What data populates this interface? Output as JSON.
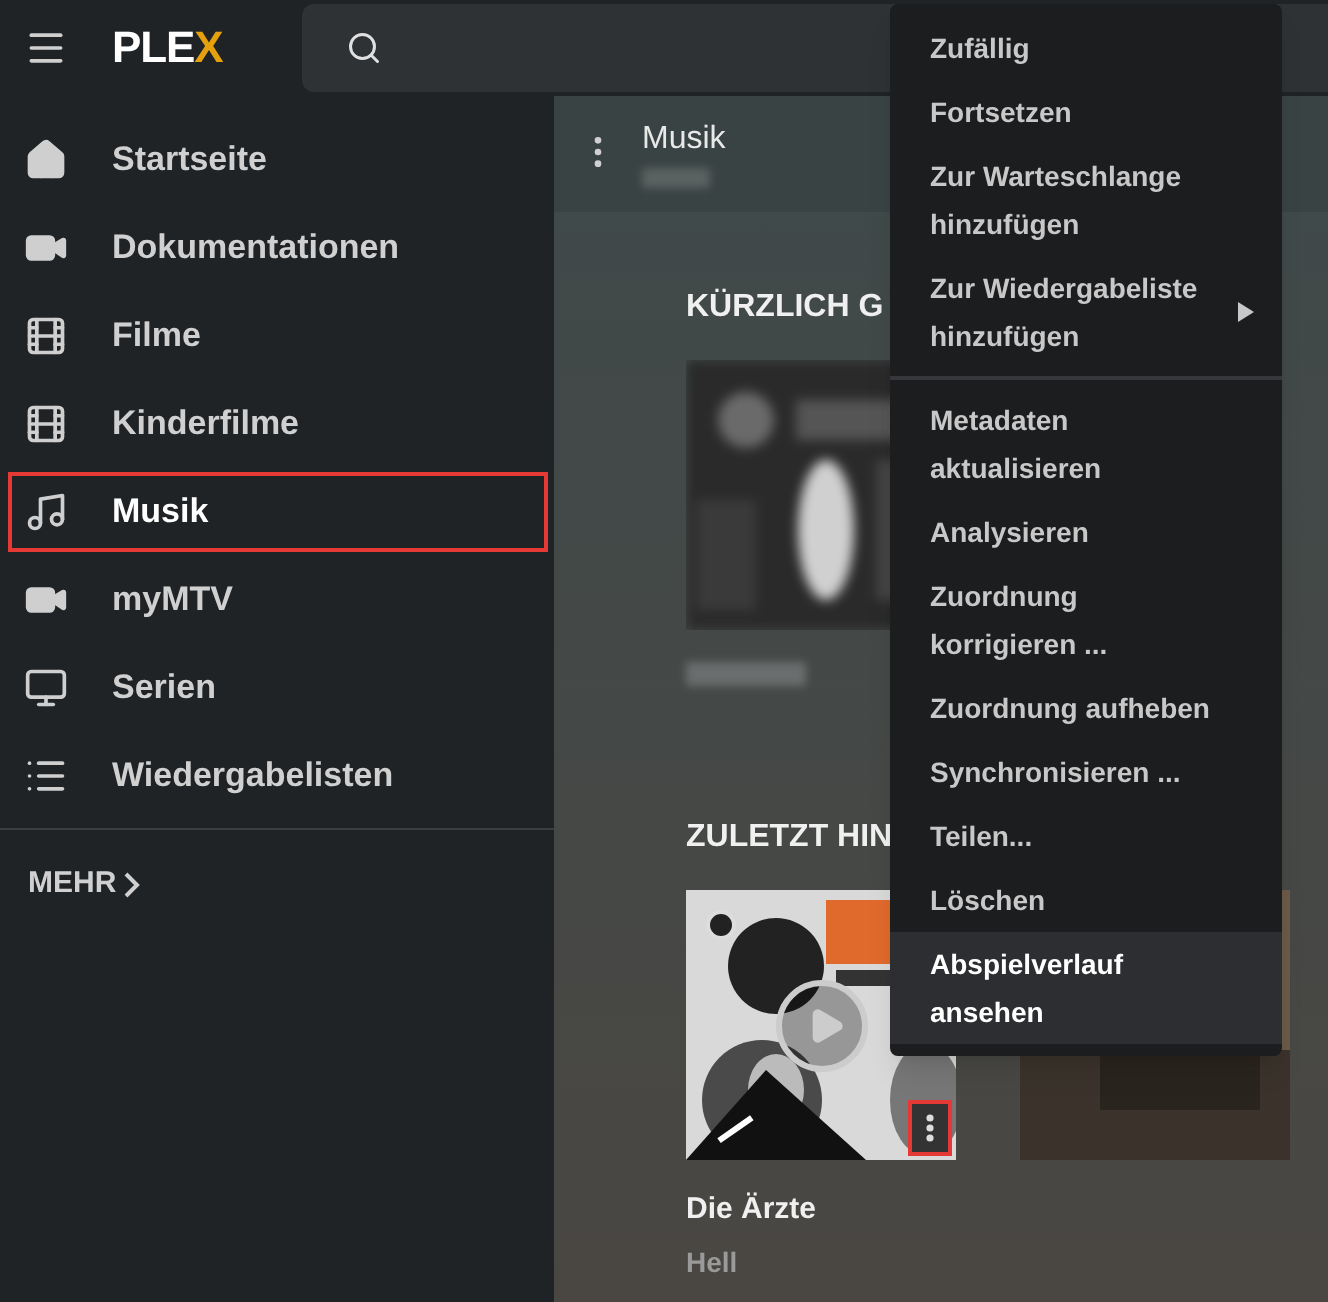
{
  "logo": {
    "text": "PLE",
    "accent": "X"
  },
  "sidebar": {
    "items": [
      {
        "label": "Startseite",
        "selected": false
      },
      {
        "label": "Dokumentationen",
        "selected": false
      },
      {
        "label": "Filme",
        "selected": false
      },
      {
        "label": "Kinderfilme",
        "selected": false
      },
      {
        "label": "Musik",
        "selected": true
      },
      {
        "label": "myMTV",
        "selected": false
      },
      {
        "label": "Serien",
        "selected": false
      },
      {
        "label": "Wiedergabelisten",
        "selected": false
      }
    ],
    "more": "MEHR"
  },
  "library": {
    "title": "Musik"
  },
  "sections": [
    {
      "heading": "KÜRZLICH G",
      "cards": [
        {
          "kind": "picture"
        }
      ]
    },
    {
      "heading": "ZULETZT HIN",
      "cards": [
        {
          "kind": "picture",
          "title": "Die Ärzte",
          "subtitle": "Hell",
          "highlighted_menu": true
        },
        {
          "kind": "picture"
        }
      ]
    }
  ],
  "context_menu": {
    "groups": [
      [
        {
          "label": "Zufällig",
          "submenu": false,
          "selected": false
        },
        {
          "label": "Fortsetzen",
          "submenu": false,
          "selected": false
        },
        {
          "label": "Zur Warteschlange hinzufügen",
          "submenu": false,
          "selected": false
        },
        {
          "label": "Zur Wiedergabeliste hinzufügen",
          "submenu": true,
          "selected": false
        }
      ],
      [
        {
          "label": "Metadaten aktualisieren",
          "submenu": false,
          "selected": false
        },
        {
          "label": "Analysieren",
          "submenu": false,
          "selected": false
        },
        {
          "label": "Zuordnung korrigieren ...",
          "submenu": false,
          "selected": false
        },
        {
          "label": "Zuordnung aufheben",
          "submenu": false,
          "selected": false
        },
        {
          "label": "Synchronisieren ...",
          "submenu": false,
          "selected": false
        },
        {
          "label": "Teilen...",
          "submenu": false,
          "selected": false
        },
        {
          "label": "Löschen",
          "submenu": false,
          "selected": false
        },
        {
          "label": "Abspielverlauf ansehen",
          "submenu": false,
          "selected": true
        }
      ]
    ]
  }
}
